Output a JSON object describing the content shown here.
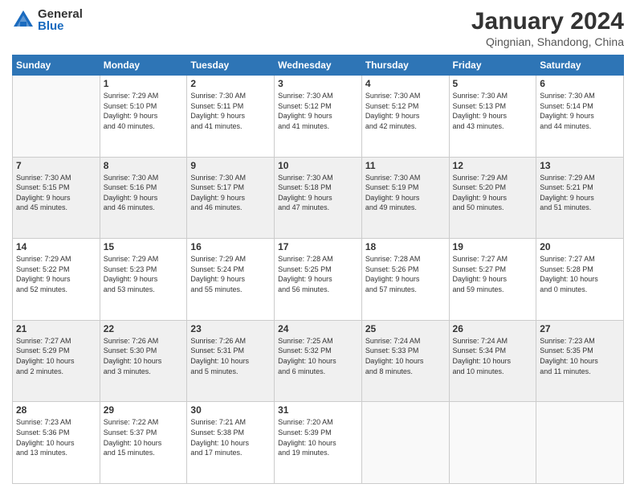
{
  "header": {
    "logo_general": "General",
    "logo_blue": "Blue",
    "month_title": "January 2024",
    "location": "Qingnian, Shandong, China"
  },
  "days_of_week": [
    "Sunday",
    "Monday",
    "Tuesday",
    "Wednesday",
    "Thursday",
    "Friday",
    "Saturday"
  ],
  "weeks": [
    {
      "shaded": false,
      "days": [
        {
          "num": "",
          "info": ""
        },
        {
          "num": "1",
          "info": "Sunrise: 7:29 AM\nSunset: 5:10 PM\nDaylight: 9 hours\nand 40 minutes."
        },
        {
          "num": "2",
          "info": "Sunrise: 7:30 AM\nSunset: 5:11 PM\nDaylight: 9 hours\nand 41 minutes."
        },
        {
          "num": "3",
          "info": "Sunrise: 7:30 AM\nSunset: 5:12 PM\nDaylight: 9 hours\nand 41 minutes."
        },
        {
          "num": "4",
          "info": "Sunrise: 7:30 AM\nSunset: 5:12 PM\nDaylight: 9 hours\nand 42 minutes."
        },
        {
          "num": "5",
          "info": "Sunrise: 7:30 AM\nSunset: 5:13 PM\nDaylight: 9 hours\nand 43 minutes."
        },
        {
          "num": "6",
          "info": "Sunrise: 7:30 AM\nSunset: 5:14 PM\nDaylight: 9 hours\nand 44 minutes."
        }
      ]
    },
    {
      "shaded": true,
      "days": [
        {
          "num": "7",
          "info": "Sunrise: 7:30 AM\nSunset: 5:15 PM\nDaylight: 9 hours\nand 45 minutes."
        },
        {
          "num": "8",
          "info": "Sunrise: 7:30 AM\nSunset: 5:16 PM\nDaylight: 9 hours\nand 46 minutes."
        },
        {
          "num": "9",
          "info": "Sunrise: 7:30 AM\nSunset: 5:17 PM\nDaylight: 9 hours\nand 46 minutes."
        },
        {
          "num": "10",
          "info": "Sunrise: 7:30 AM\nSunset: 5:18 PM\nDaylight: 9 hours\nand 47 minutes."
        },
        {
          "num": "11",
          "info": "Sunrise: 7:30 AM\nSunset: 5:19 PM\nDaylight: 9 hours\nand 49 minutes."
        },
        {
          "num": "12",
          "info": "Sunrise: 7:29 AM\nSunset: 5:20 PM\nDaylight: 9 hours\nand 50 minutes."
        },
        {
          "num": "13",
          "info": "Sunrise: 7:29 AM\nSunset: 5:21 PM\nDaylight: 9 hours\nand 51 minutes."
        }
      ]
    },
    {
      "shaded": false,
      "days": [
        {
          "num": "14",
          "info": "Sunrise: 7:29 AM\nSunset: 5:22 PM\nDaylight: 9 hours\nand 52 minutes."
        },
        {
          "num": "15",
          "info": "Sunrise: 7:29 AM\nSunset: 5:23 PM\nDaylight: 9 hours\nand 53 minutes."
        },
        {
          "num": "16",
          "info": "Sunrise: 7:29 AM\nSunset: 5:24 PM\nDaylight: 9 hours\nand 55 minutes."
        },
        {
          "num": "17",
          "info": "Sunrise: 7:28 AM\nSunset: 5:25 PM\nDaylight: 9 hours\nand 56 minutes."
        },
        {
          "num": "18",
          "info": "Sunrise: 7:28 AM\nSunset: 5:26 PM\nDaylight: 9 hours\nand 57 minutes."
        },
        {
          "num": "19",
          "info": "Sunrise: 7:27 AM\nSunset: 5:27 PM\nDaylight: 9 hours\nand 59 minutes."
        },
        {
          "num": "20",
          "info": "Sunrise: 7:27 AM\nSunset: 5:28 PM\nDaylight: 10 hours\nand 0 minutes."
        }
      ]
    },
    {
      "shaded": true,
      "days": [
        {
          "num": "21",
          "info": "Sunrise: 7:27 AM\nSunset: 5:29 PM\nDaylight: 10 hours\nand 2 minutes."
        },
        {
          "num": "22",
          "info": "Sunrise: 7:26 AM\nSunset: 5:30 PM\nDaylight: 10 hours\nand 3 minutes."
        },
        {
          "num": "23",
          "info": "Sunrise: 7:26 AM\nSunset: 5:31 PM\nDaylight: 10 hours\nand 5 minutes."
        },
        {
          "num": "24",
          "info": "Sunrise: 7:25 AM\nSunset: 5:32 PM\nDaylight: 10 hours\nand 6 minutes."
        },
        {
          "num": "25",
          "info": "Sunrise: 7:24 AM\nSunset: 5:33 PM\nDaylight: 10 hours\nand 8 minutes."
        },
        {
          "num": "26",
          "info": "Sunrise: 7:24 AM\nSunset: 5:34 PM\nDaylight: 10 hours\nand 10 minutes."
        },
        {
          "num": "27",
          "info": "Sunrise: 7:23 AM\nSunset: 5:35 PM\nDaylight: 10 hours\nand 11 minutes."
        }
      ]
    },
    {
      "shaded": false,
      "days": [
        {
          "num": "28",
          "info": "Sunrise: 7:23 AM\nSunset: 5:36 PM\nDaylight: 10 hours\nand 13 minutes."
        },
        {
          "num": "29",
          "info": "Sunrise: 7:22 AM\nSunset: 5:37 PM\nDaylight: 10 hours\nand 15 minutes."
        },
        {
          "num": "30",
          "info": "Sunrise: 7:21 AM\nSunset: 5:38 PM\nDaylight: 10 hours\nand 17 minutes."
        },
        {
          "num": "31",
          "info": "Sunrise: 7:20 AM\nSunset: 5:39 PM\nDaylight: 10 hours\nand 19 minutes."
        },
        {
          "num": "",
          "info": ""
        },
        {
          "num": "",
          "info": ""
        },
        {
          "num": "",
          "info": ""
        }
      ]
    }
  ]
}
